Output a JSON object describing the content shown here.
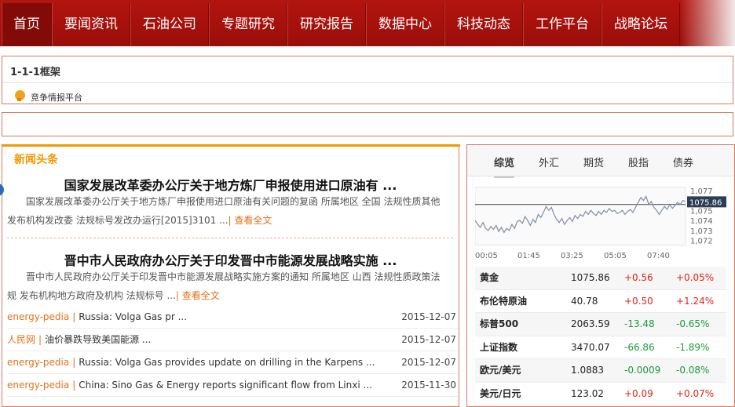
{
  "nav": {
    "items": [
      "首页",
      "要闻资讯",
      "石油公司",
      "专题研究",
      "研究报告",
      "数据中心",
      "科技动态",
      "工作平台",
      "战略论坛"
    ],
    "active": "首页"
  },
  "breadcrumb": {
    "title": "1-1-1框架",
    "platform_label": "竞争情报平台",
    "platform_icon": "chat-bubble-icon"
  },
  "news": {
    "tab_title": "新闻头条",
    "headlines": [
      {
        "title": "国家发展改革委办公厅关于地方炼厂申报使用进口原油有 ...",
        "summary": "国家发展改革委办公厅关于地方炼厂申报使用进口原油有关问题的复函 所属地区 全国 法规性质其他 发布机构发改委 法规标号发改办运行[2015]3101 ...",
        "more": "| 查看全文"
      },
      {
        "title": "晋中市人民政府办公厅关于印发晋中市能源发展战略实施 ...",
        "summary": "晋中市人民政府办公厅关于印发晋中市能源发展战略实施方案的通知 所属地区 山西 法规性质政策法规 发布机构地方政府及机构 法规标号 ...",
        "more": "| 查看全文"
      }
    ],
    "list": [
      {
        "source": "energy-pedia",
        "title": "Russia: Volga Gas pr ...",
        "date": "2015-12-07"
      },
      {
        "source": "人民网",
        "title": "油价暴跌导致美国能源 ...",
        "date": "2015-12-07"
      },
      {
        "source": "energy-pedia",
        "title": "Russia: Volga Gas provides update on drilling in the Karpens ...",
        "date": "2015-12-07"
      },
      {
        "source": "energy-pedia",
        "title": "China: Sino Gas & Energy reports significant flow from Linxi ...",
        "date": "2015-11-30"
      }
    ]
  },
  "market": {
    "tabs": [
      "综览",
      "外汇",
      "期货",
      "股指",
      "债券"
    ],
    "active_tab": "综览",
    "chart": {
      "y_ticks": [
        "1,077",
        "1,076",
        "1,075",
        "1,074",
        "1,073",
        "1,072"
      ],
      "x_ticks": [
        "00:05",
        "01:45",
        "03:25",
        "05:05",
        "07:40"
      ],
      "current_label": "1075.86",
      "reference": 1075.6,
      "ymin": 1071.5,
      "ymax": 1077.3,
      "values": [
        1074.0,
        1073.6,
        1073.3,
        1073.8,
        1073.2,
        1073.0,
        1073.4,
        1073.1,
        1073.5,
        1072.9,
        1073.3,
        1072.8,
        1073.2,
        1073.0,
        1073.6,
        1073.2,
        1073.9,
        1074.0,
        1073.7,
        1074.4,
        1074.0,
        1073.5,
        1074.1,
        1073.8,
        1074.6,
        1074.3,
        1074.8,
        1075.4,
        1075.0,
        1075.3,
        1074.6,
        1074.1,
        1073.8,
        1074.2,
        1073.6,
        1074.0,
        1074.3,
        1073.9,
        1074.5,
        1074.2,
        1074.6,
        1074.4,
        1074.9,
        1074.6,
        1075.0,
        1074.7,
        1074.5,
        1074.9,
        1074.6,
        1075.0,
        1074.8,
        1075.2,
        1074.9,
        1075.0,
        1074.7,
        1074.8,
        1075.0,
        1074.6,
        1074.9,
        1075.1,
        1074.8,
        1075.3,
        1075.8,
        1076.3,
        1076.0,
        1076.4,
        1075.6,
        1075.9,
        1075.3,
        1075.0,
        1074.6,
        1075.0,
        1075.4,
        1075.1,
        1075.6,
        1075.2,
        1075.5,
        1075.8,
        1075.6,
        1076.0,
        1075.9
      ]
    },
    "rows": [
      {
        "name": "黄金",
        "price": "1075.86",
        "change": "+0.56",
        "pct": "+0.05%",
        "dir": "up"
      },
      {
        "name": "布伦特原油",
        "price": "40.78",
        "change": "+0.50",
        "pct": "+1.24%",
        "dir": "up"
      },
      {
        "name": "标普500",
        "price": "2063.59",
        "change": "-13.48",
        "pct": "-0.65%",
        "dir": "down"
      },
      {
        "name": "上证指数",
        "price": "3470.07",
        "change": "-66.86",
        "pct": "-1.89%",
        "dir": "down"
      },
      {
        "name": "欧元/美元",
        "price": "1.0883",
        "change": "-0.0009",
        "pct": "-0.08%",
        "dir": "down"
      },
      {
        "name": "美元/日元",
        "price": "123.02",
        "change": "+0.09",
        "pct": "+0.07%",
        "dir": "up"
      }
    ]
  },
  "colors": {
    "nav_bg": "#a8110c",
    "accent_orange": "#f39800",
    "link_orange": "#e6711a",
    "up_red": "#e2231a",
    "down_green": "#1a9b3b"
  }
}
